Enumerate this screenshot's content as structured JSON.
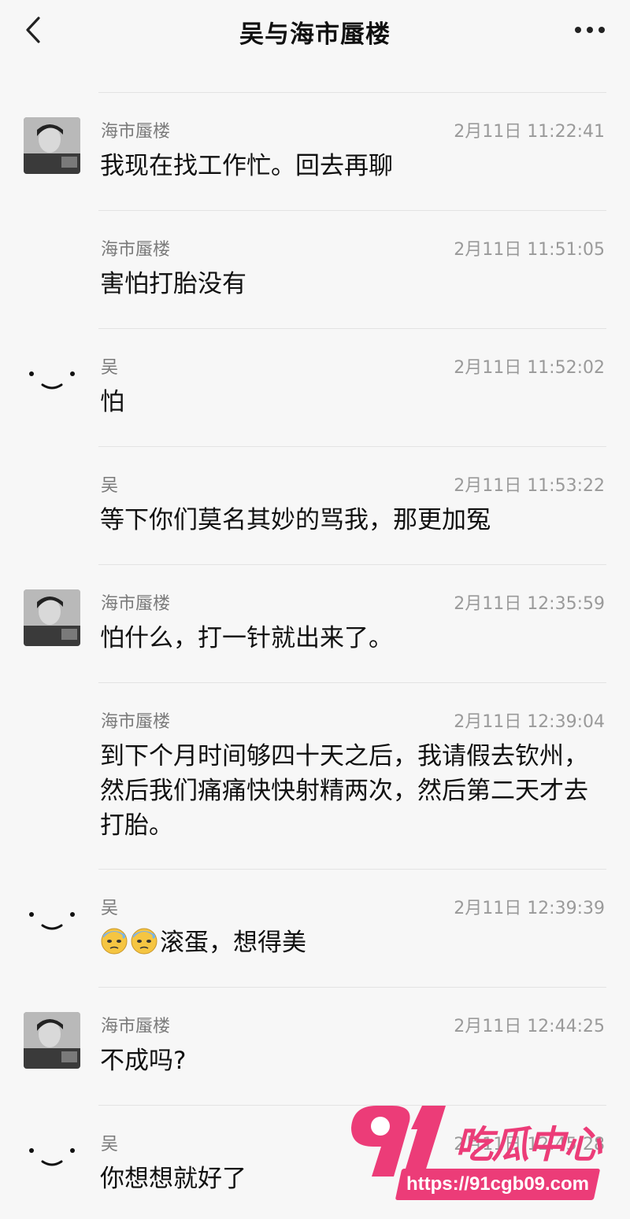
{
  "header": {
    "title": "吴与海市蜃楼"
  },
  "messages": [
    {
      "sender": "海市蜃楼",
      "time": "2月11日 11:22:41",
      "text": "我现在找工作忙。回去再聊",
      "avatar": "photo"
    },
    {
      "sender": "海市蜃楼",
      "time": "2月11日 11:51:05",
      "text": "害怕打胎没有",
      "avatar": "none"
    },
    {
      "sender": "吴",
      "time": "2月11日 11:52:02",
      "text": "怕",
      "avatar": "smile"
    },
    {
      "sender": "吴",
      "time": "2月11日 11:53:22",
      "text": "等下你们莫名其妙的骂我，那更加冤",
      "avatar": "none"
    },
    {
      "sender": "海市蜃楼",
      "time": "2月11日 12:35:59",
      "text": "怕什么，打一针就出来了。",
      "avatar": "photo"
    },
    {
      "sender": "海市蜃楼",
      "time": "2月11日 12:39:04",
      "text": "到下个月时间够四十天之后，我请假去钦州，然后我们痛痛快快射精两次，然后第二天才去打胎。",
      "avatar": "none"
    },
    {
      "sender": "吴",
      "time": "2月11日 12:39:39",
      "text": "滚蛋，想得美",
      "avatar": "smile",
      "emoji_prefix": [
        "cold-sweat-emoji",
        "cold-sweat-emoji"
      ]
    },
    {
      "sender": "海市蜃楼",
      "time": "2月11日 12:44:25",
      "text": "不成吗?",
      "avatar": "photo"
    },
    {
      "sender": "吴",
      "time": "2月11日 12:45:28",
      "text": "你想想就好了",
      "avatar": "smile"
    }
  ],
  "watermark": {
    "logo": "91",
    "name": "吃瓜中心",
    "url": "https://91cgb09.com",
    "color": "#ec3c78"
  },
  "colors": {
    "background": "#f7f7f7",
    "sender": "#7a7a7a",
    "time": "#9a9a9a",
    "divider": "#e3e3e3"
  }
}
